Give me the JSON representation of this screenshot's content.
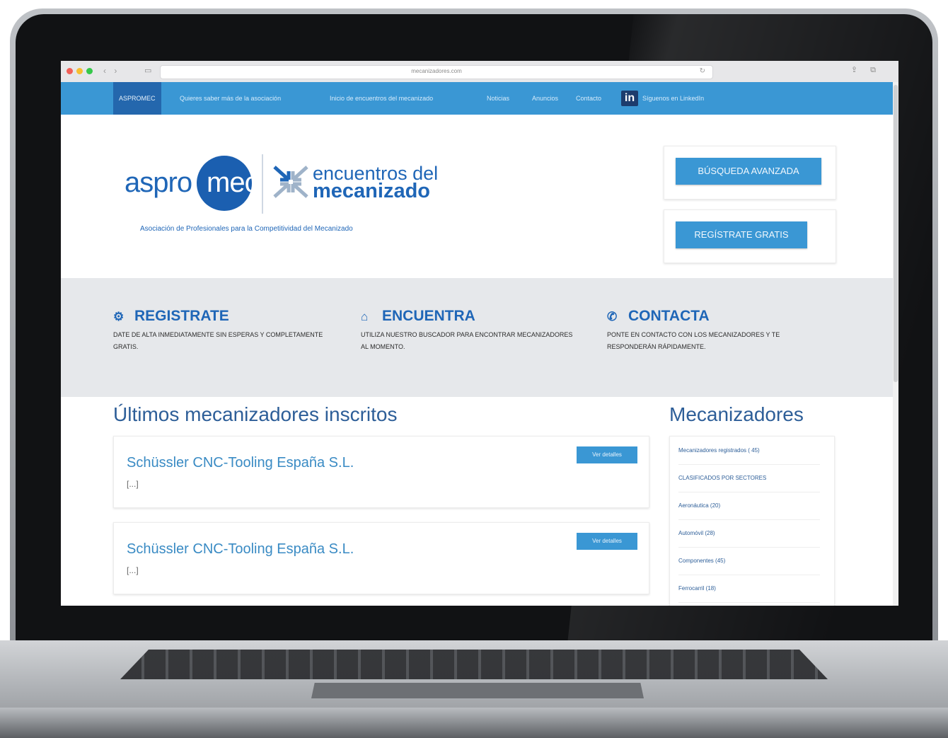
{
  "browser": {
    "url": "mecanizadores.com",
    "nav_arrows": "‹ ›",
    "sidebar_icon": "sidebar-icon",
    "reload_icon": "↻",
    "share_icon": "share-icon",
    "tabs_icon": "tabs-icon"
  },
  "topnav": {
    "brand": "ASPROMEC",
    "items": [
      "Quieres saber más de la asociación",
      "Inicio de encuentros del mecanizado",
      "Noticias",
      "Anuncios",
      "Contacto",
      "Síguenos en LinkedIn"
    ],
    "linkedin_label": "in"
  },
  "logo": {
    "part1": "aspro",
    "part2": "mec",
    "enc_line1": "encuentros del",
    "enc_line2": "mecanizado",
    "tagline": "Asociación de Profesionales para la Competitividad del Mecanizado"
  },
  "cta": {
    "advanced_search": "BÚSQUEDA AVANZADA",
    "register_free": "REGÍSTRATE GRATIS"
  },
  "features": [
    {
      "icon": "⚙",
      "title": "REGISTRATE",
      "text": "DATE DE ALTA INMEDIATAMENTE SIN ESPERAS Y COMPLETAMENTE GRATIS."
    },
    {
      "icon": "⌂",
      "title": "ENCUENTRA",
      "text": "UTILIZA NUESTRO BUSCADOR PARA ENCONTRAR MECANIZADORES AL MOMENTO."
    },
    {
      "icon": "✆",
      "title": "CONTACTA",
      "text": "PONTE EN CONTACTO CON LOS MECANIZADORES Y TE RESPONDERÁN RÁPIDAMENTE."
    }
  ],
  "latest": {
    "title": "Últimos mecanizadores inscritos",
    "cards": [
      {
        "name": "Schüssler CNC-Tooling España S.L.",
        "sub": "[...]",
        "button": "Ver detalles"
      },
      {
        "name": "Schüssler CNC-Tooling España S.L.",
        "sub": "[...]",
        "button": "Ver detalles"
      }
    ]
  },
  "mecanizadores": {
    "title": "Mecanizadores",
    "items": [
      "Mecanizadores registrados ( 45)",
      "CLASIFICADOS POR SECTORES",
      "Aeronáutica (20)",
      "Automóvil (28)",
      "Componentes (45)",
      "Ferrocarril (18)"
    ]
  },
  "colors": {
    "nav_blue": "#3a97d4",
    "brand_blue": "#1f66b7",
    "dark_blue": "#2467ad"
  }
}
